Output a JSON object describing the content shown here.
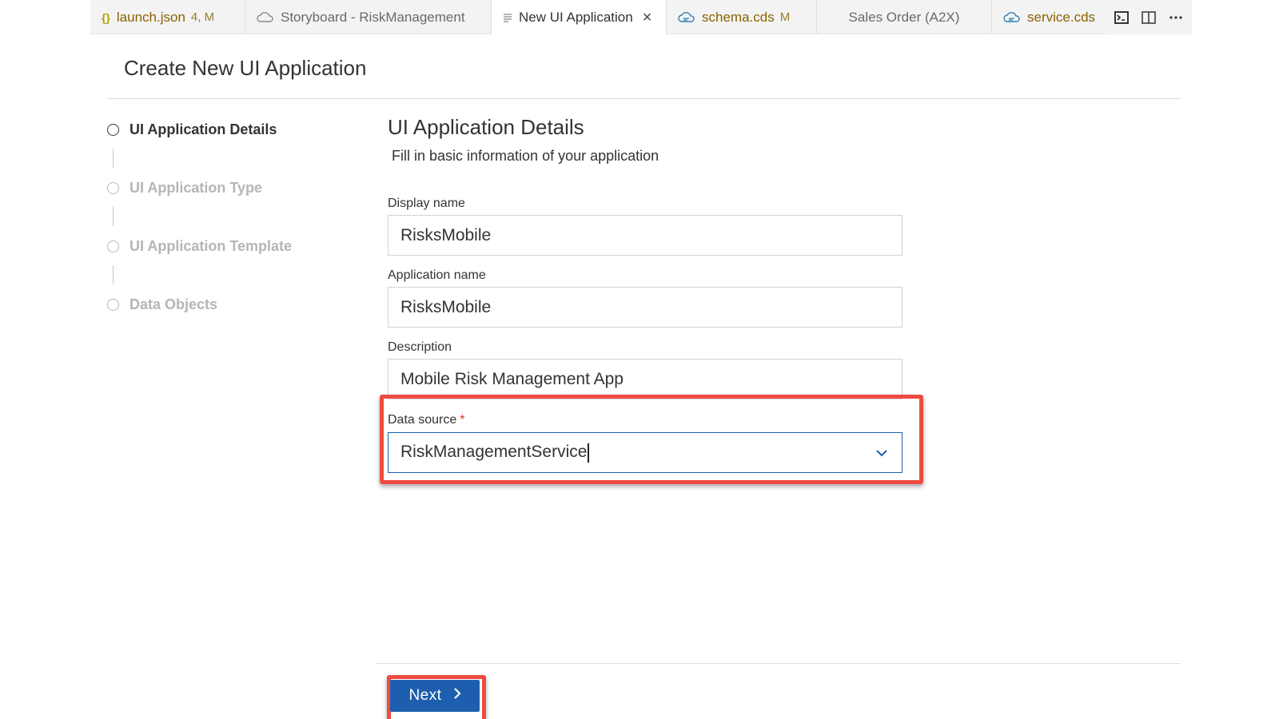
{
  "tabs": [
    {
      "label": "launch.json",
      "modifier": "4, M",
      "icon": "json-braces-icon"
    },
    {
      "label": "Storyboard - RiskManagement",
      "modifier": "",
      "icon": "cloud-icon"
    },
    {
      "label": "New UI Application",
      "modifier": "",
      "icon": "document-lines-icon",
      "active": true,
      "close": "×"
    },
    {
      "label": "schema.cds",
      "modifier": "M",
      "icon": "cds-cloud-icon"
    },
    {
      "label": "Sales Order (A2X)",
      "modifier": "",
      "icon": ""
    },
    {
      "label": "service.cds",
      "modifier": "",
      "icon": "cds-cloud-icon"
    }
  ],
  "tab_actions": [
    "terminal-icon",
    "split-editor-icon",
    "more-icon"
  ],
  "page": {
    "title": "Create New UI Application"
  },
  "steps": [
    {
      "label": "UI Application Details",
      "active": true
    },
    {
      "label": "UI Application Type",
      "active": false
    },
    {
      "label": "UI Application Template",
      "active": false
    },
    {
      "label": "Data Objects",
      "active": false
    }
  ],
  "form": {
    "section_title": "UI Application Details",
    "section_subtitle": "Fill in basic information of your application",
    "display_name": {
      "label": "Display name",
      "value": "RisksMobile"
    },
    "application_name": {
      "label": "Application name",
      "value": "RisksMobile"
    },
    "description": {
      "label": "Description",
      "value": "Mobile Risk Management App"
    },
    "data_source": {
      "label": "Data source",
      "required_mark": "*",
      "value": "RiskManagementService"
    }
  },
  "footer": {
    "next_label": "Next"
  },
  "colors": {
    "accent": "#1d5fae",
    "highlight": "#ef4b41",
    "required": "#d9342b"
  }
}
